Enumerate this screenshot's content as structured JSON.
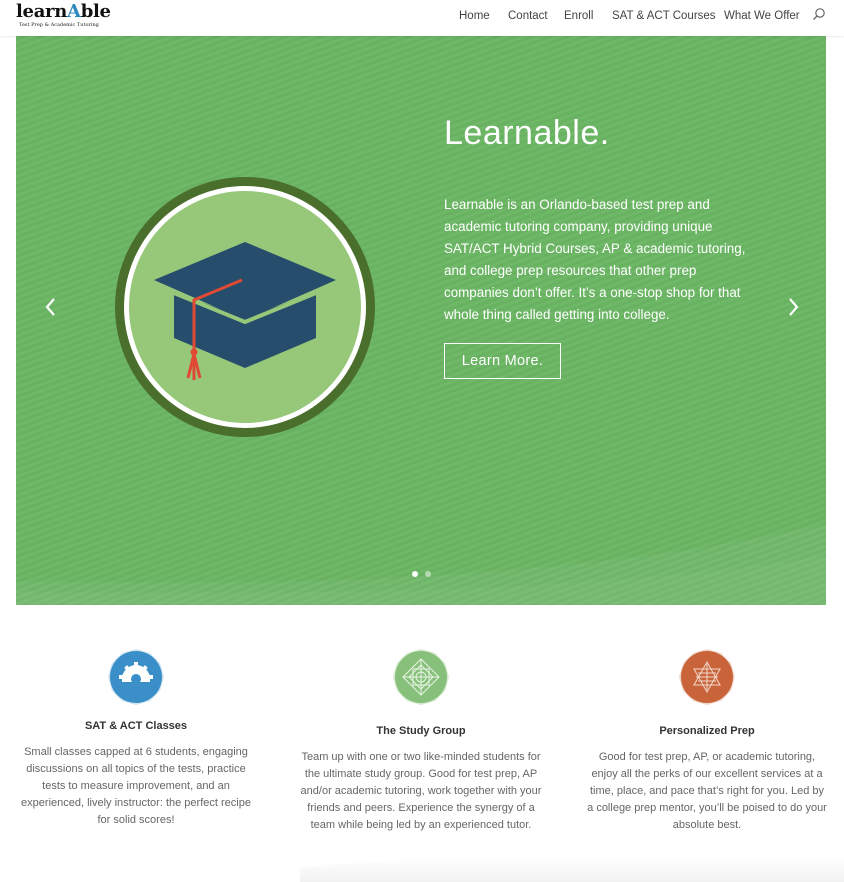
{
  "logo": {
    "word_before": "learn",
    "word_accent": "A",
    "word_after": "ble",
    "tagline": "Test Prep & Academic Tutoring"
  },
  "nav": {
    "items": [
      "Home",
      "Contact",
      "Enroll",
      "SAT & ACT Courses",
      "What We Offer"
    ],
    "search_icon": "search-icon"
  },
  "hero": {
    "title": "Learnable.",
    "body": "Learnable is an Orlando-based test prep and academic tutoring company, providing unique SAT/ACT Hybrid Courses, AP & academic tutoring, and college prep resources that other prep companies don’t offer. It’s a one-stop shop for that whole thing called getting into college.",
    "button": "Learn More.",
    "prev_icon": "chevron-left-icon",
    "next_icon": "chevron-right-icon",
    "emblem_icon": "graduation-cap-icon",
    "slide_count": 2,
    "active_slide": 1,
    "colors": {
      "background": "#6ab563",
      "emblem_ring": "#4a6e2c",
      "emblem_fill": "#97c87a",
      "cap": "#264d6b",
      "tassel": "#e04a35"
    }
  },
  "features": [
    {
      "icon": "gear-icon",
      "icon_color": "#3a8fc8",
      "title": "SAT & ACT Classes",
      "text": "Small classes capped at 6 students, engaging discussions on all topics of the tests, practice tests to measure improvement, and an experienced, lively instructor: the perfect recipe for solid scores!"
    },
    {
      "icon": "diamond-pattern-icon",
      "icon_color": "#86c07a",
      "title": "The Study Group",
      "text": "Team up with one or two like-minded students for the ultimate study group. Good for test prep, AP and/or academic tutoring, work together with your friends and peers. Experience the synergy of a team while being led by an experienced tutor."
    },
    {
      "icon": "star-pattern-icon",
      "icon_color": "#c9643a",
      "title": "Personalized Prep",
      "text": "Good for test prep, AP, or academic tutoring, enjoy all the perks of our excellent services at a time, place, and pace that’s right for you. Led by a college prep mentor, you’ll be poised to do your absolute best."
    }
  ]
}
